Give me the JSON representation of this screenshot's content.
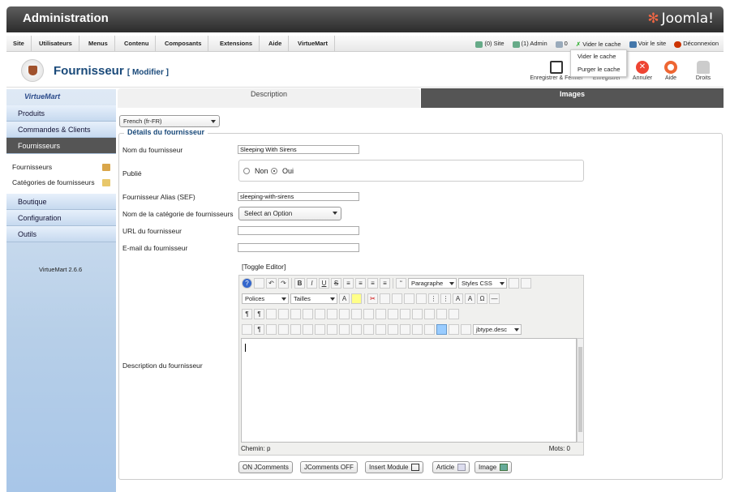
{
  "header": {
    "title": "Administration",
    "logo": "Joomla!"
  },
  "menu": {
    "items": [
      "Site",
      "Utilisateurs",
      "Menus",
      "Contenu",
      "Composants",
      "Extensions",
      "Aide",
      "VirtueMart"
    ]
  },
  "status": {
    "site": "(0) Site",
    "admin": "(1) Admin",
    "messages": "0",
    "clear_cache": "Vider le cache",
    "view_site": "Voir le site",
    "logout": "Déconnexion"
  },
  "cache_menu": [
    "Vider le cache",
    "Purger le cache"
  ],
  "toolbar": {
    "title": "Fournisseur",
    "subtitle": "[ Modifier ]",
    "save_close": "Enregistrer & Fermer",
    "save": "Enregistrer",
    "cancel": "Annuler",
    "help": "Aide",
    "rights": "Droits"
  },
  "sidebar": {
    "logo": "VirtueMart",
    "items": [
      "Produits",
      "Commandes & Clients",
      "Fournisseurs"
    ],
    "sub": [
      "Fournisseurs",
      "Catégories de fournisseurs"
    ],
    "items2": [
      "Boutique",
      "Configuration",
      "Outils"
    ],
    "version": "VirtueMart 2.6.6"
  },
  "tabs": {
    "desc": "Description",
    "images": "Images"
  },
  "lang": "French (fr-FR)",
  "form": {
    "legend": "Détails du fournisseur",
    "name_label": "Nom du fournisseur",
    "name_value": "Sleeping With Sirens",
    "pub_label": "Publié",
    "pub_no": "Non",
    "pub_yes": "Oui",
    "alias_label": "Fournisseur Alias (SEF)",
    "alias_value": "sleeping-with-sirens",
    "cat_label": "Nom de la catégorie de fournisseurs",
    "cat_value": "Select an Option",
    "url_label": "URL du fournisseur",
    "email_label": "E-mail du fournisseur",
    "desc_label": "Description du fournisseur"
  },
  "editor": {
    "toggle": "[Toggle Editor]",
    "paragraph": "Paragraphe",
    "styles": "Styles CSS",
    "fonts": "Polices",
    "sizes": "Tailles",
    "class_sel": "jbtype.desc",
    "path": "Chemin: p",
    "words": "Mots: 0"
  },
  "buttons": [
    "ON JComments",
    "JComments OFF",
    "Insert Module",
    "Article",
    "Image"
  ]
}
